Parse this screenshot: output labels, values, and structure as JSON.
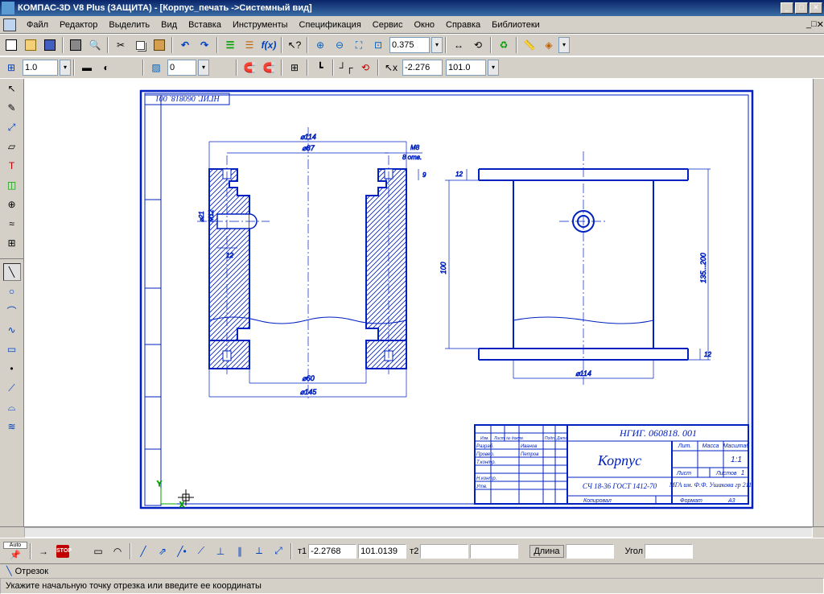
{
  "title": "КОМПАС-3D V8 Plus (ЗАЩИТА) - [Корпус_печать ->Системный вид]",
  "window_buttons": {
    "min": "_",
    "max": "□",
    "close": "✕"
  },
  "menu": [
    "Файл",
    "Редактор",
    "Выделить",
    "Вид",
    "Вставка",
    "Инструменты",
    "Спецификация",
    "Сервис",
    "Окно",
    "Справка",
    "Библиотеки"
  ],
  "tb1": {
    "zoom_value": "0.375"
  },
  "tb2": {
    "linewidth": "1.0",
    "layer": "0",
    "coord1": "-2.276",
    "coord2": "101.0"
  },
  "left_tools": [
    "↖",
    "🖉",
    "⤢",
    "📐",
    "□",
    "◈",
    "◐",
    "≈",
    "⊞",
    "⊟",
    "─",
    "◯",
    "⌒",
    "∿",
    "⟋",
    "⊡",
    "⟍",
    "⌓",
    "≋"
  ],
  "bottom": {
    "t1_label": "т1",
    "t1x": "-2.2768",
    "t1y": "101.0139",
    "t2_label": "т2",
    "t2x": "",
    "t2y": "",
    "len_label": "Длина",
    "len_val": "",
    "ang_label": "Угол",
    "ang_val": ""
  },
  "mode": "Отрезок",
  "status": "Укажите начальную точку отрезка или введите ее координаты",
  "drawing": {
    "code_top": "НГИГ. 060818. 001",
    "dimensions": {
      "d114": "⌀114",
      "d87": "⌀87",
      "m8": "M8",
      "holes": "8 отв.",
      "d9": "9",
      "d21": "⌀21",
      "m12": "M12",
      "d12_left": "12",
      "d60": "⌀60",
      "d145": "⌀145",
      "s100": "100",
      "s12": "12",
      "s12r": "12",
      "s135": "135...200",
      "d114r": "⌀114"
    },
    "tb_code": "НГИГ. 060818. 001",
    "tb_name": "Корпус",
    "tb_material": "СЧ 18-36 ГОСТ 1412-70",
    "tb_org": "МГА им. Ф.Ф. Ушакова гр 211",
    "tb_qty": "1:1",
    "tb_lit": "Лит.",
    "tb_mass": "Масса",
    "tb_scale": "Масштаб",
    "tb_sheet": "Лист",
    "tb_sheets": "Листов",
    "tb_sheets_n": "1",
    "tb_format": "Формат",
    "tb_a3": "А3",
    "tb_rows": [
      "Разраб.",
      "Провер.",
      "Т.контр.",
      "",
      "Н.контр.",
      "Утв."
    ],
    "tb_names": [
      "Иванов",
      "Петров"
    ],
    "tb_copied": "Копировал",
    "tb_cols": [
      "Изм.",
      "Лист",
      "№ докум.",
      "Подп.",
      "Дата"
    ]
  }
}
